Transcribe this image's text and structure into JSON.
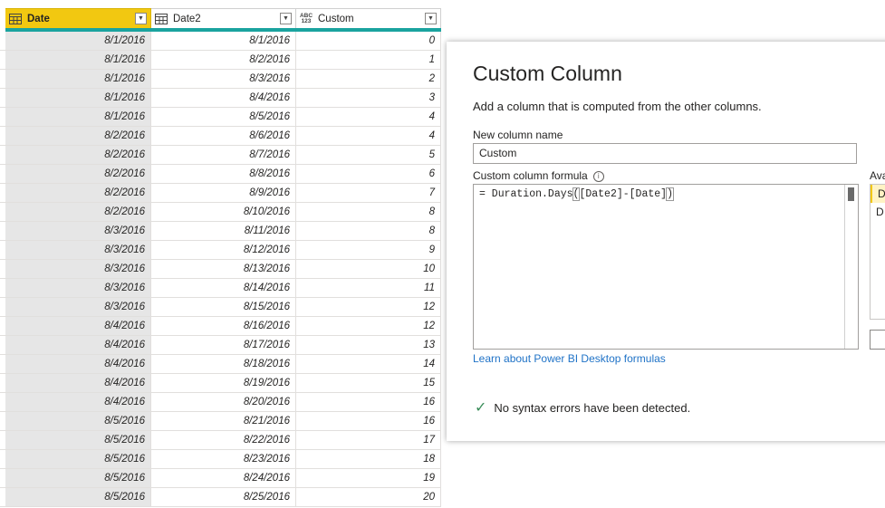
{
  "columns": [
    {
      "name": "Date",
      "type_icon": "calendar-icon"
    },
    {
      "name": "Date2",
      "type_icon": "calendar-icon"
    },
    {
      "name": "Custom",
      "type_icon": "abc-123-icon",
      "type_label_top": "ABC",
      "type_label_bottom": "123"
    }
  ],
  "rows": [
    [
      "8/1/2016",
      "8/1/2016",
      "0"
    ],
    [
      "8/1/2016",
      "8/2/2016",
      "1"
    ],
    [
      "8/1/2016",
      "8/3/2016",
      "2"
    ],
    [
      "8/1/2016",
      "8/4/2016",
      "3"
    ],
    [
      "8/1/2016",
      "8/5/2016",
      "4"
    ],
    [
      "8/2/2016",
      "8/6/2016",
      "4"
    ],
    [
      "8/2/2016",
      "8/7/2016",
      "5"
    ],
    [
      "8/2/2016",
      "8/8/2016",
      "6"
    ],
    [
      "8/2/2016",
      "8/9/2016",
      "7"
    ],
    [
      "8/2/2016",
      "8/10/2016",
      "8"
    ],
    [
      "8/3/2016",
      "8/11/2016",
      "8"
    ],
    [
      "8/3/2016",
      "8/12/2016",
      "9"
    ],
    [
      "8/3/2016",
      "8/13/2016",
      "10"
    ],
    [
      "8/3/2016",
      "8/14/2016",
      "11"
    ],
    [
      "8/3/2016",
      "8/15/2016",
      "12"
    ],
    [
      "8/4/2016",
      "8/16/2016",
      "12"
    ],
    [
      "8/4/2016",
      "8/17/2016",
      "13"
    ],
    [
      "8/4/2016",
      "8/18/2016",
      "14"
    ],
    [
      "8/4/2016",
      "8/19/2016",
      "15"
    ],
    [
      "8/4/2016",
      "8/20/2016",
      "16"
    ],
    [
      "8/5/2016",
      "8/21/2016",
      "16"
    ],
    [
      "8/5/2016",
      "8/22/2016",
      "17"
    ],
    [
      "8/5/2016",
      "8/23/2016",
      "18"
    ],
    [
      "8/5/2016",
      "8/24/2016",
      "19"
    ],
    [
      "8/5/2016",
      "8/25/2016",
      "20"
    ]
  ],
  "dialog": {
    "title": "Custom Column",
    "subtitle": "Add a column that is computed from the other columns.",
    "name_label": "New column name",
    "name_value": "Custom",
    "formula_label": "Custom column formula",
    "formula_prefix": "= Duration.Days",
    "formula_open": "(",
    "formula_args": "[Date2]-[Date]",
    "formula_close": ")",
    "learn_link": "Learn about Power BI Desktop formulas",
    "status": "No syntax errors have been detected.",
    "available_label": "Ava",
    "available_items": [
      "D",
      "D"
    ]
  },
  "colors": {
    "selected_header": "#f2c811",
    "quality_bar": "#1aa39f",
    "link": "#2073c7",
    "success": "#3a8d5a"
  }
}
